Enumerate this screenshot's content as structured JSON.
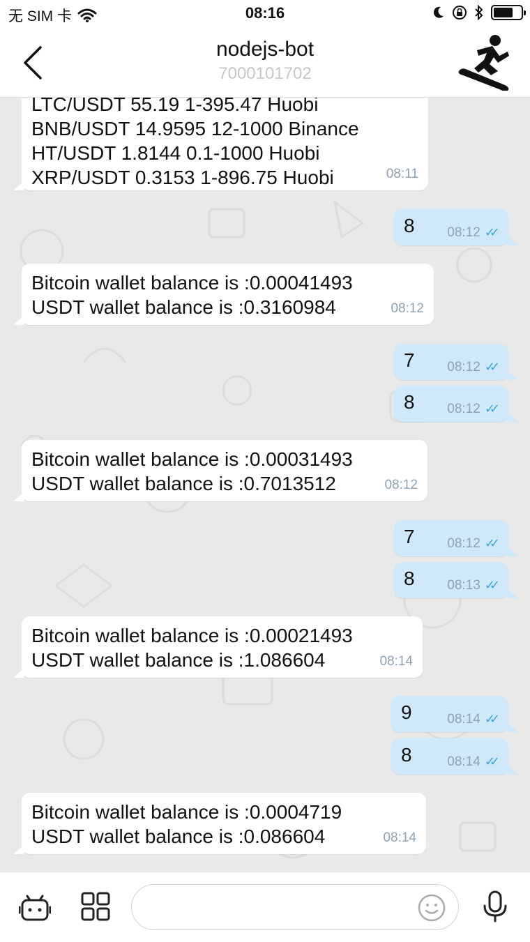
{
  "status_bar": {
    "carrier": "无 SIM 卡",
    "time": "08:16"
  },
  "header": {
    "title": "nodejs-bot",
    "subtitle": "7000101702",
    "back_icon": "chevron-left-icon",
    "avatar_icon": "snowboarder-icon"
  },
  "messages": [
    {
      "dir": "in",
      "lines": [
        "LTC/USDT 55.19 1-395.47 Huobi",
        "BNB/USDT 14.9595 12-1000 Binance",
        "HT/USDT 1.8144 0.1-1000 Huobi",
        "XRP/USDT 0.3153 1-896.75 Huobi"
      ],
      "time": "08:11"
    },
    {
      "dir": "out",
      "text": "8",
      "time": "08:12"
    },
    {
      "dir": "in",
      "lines": [
        "Bitcoin wallet balance is :0.00041493",
        "USDT wallet balance is :0.3160984"
      ],
      "time": "08:12"
    },
    {
      "dir": "out",
      "text": "7",
      "time": "08:12"
    },
    {
      "dir": "out",
      "text": "8",
      "time": "08:12"
    },
    {
      "dir": "in",
      "lines": [
        "Bitcoin wallet balance is :0.00031493",
        "USDT wallet balance is :0.7013512"
      ],
      "time": "08:12"
    },
    {
      "dir": "out",
      "text": "7",
      "time": "08:12"
    },
    {
      "dir": "out",
      "text": "8",
      "time": "08:13"
    },
    {
      "dir": "in",
      "lines": [
        "Bitcoin wallet balance is :0.00021493",
        "USDT wallet balance is :1.086604"
      ],
      "time": "08:14"
    },
    {
      "dir": "out",
      "text": "9",
      "time": "08:14"
    },
    {
      "dir": "out",
      "text": "8",
      "time": "08:14"
    },
    {
      "dir": "in",
      "lines": [
        "Bitcoin wallet balance is :0.0004719",
        "USDT wallet balance is :0.086604"
      ],
      "time": "08:14"
    }
  ],
  "input_bar": {
    "bot_icon": "bot-keyboard-icon",
    "grid_icon": "grid-menu-icon",
    "placeholder": "",
    "emoji_icon": "smiley-icon",
    "mic_icon": "microphone-icon"
  },
  "colors": {
    "incoming_bubble": "#ffffff",
    "outgoing_bubble": "#cfe9fb",
    "chat_background": "#e9e9e9",
    "read_check": "#3ba7d8"
  }
}
